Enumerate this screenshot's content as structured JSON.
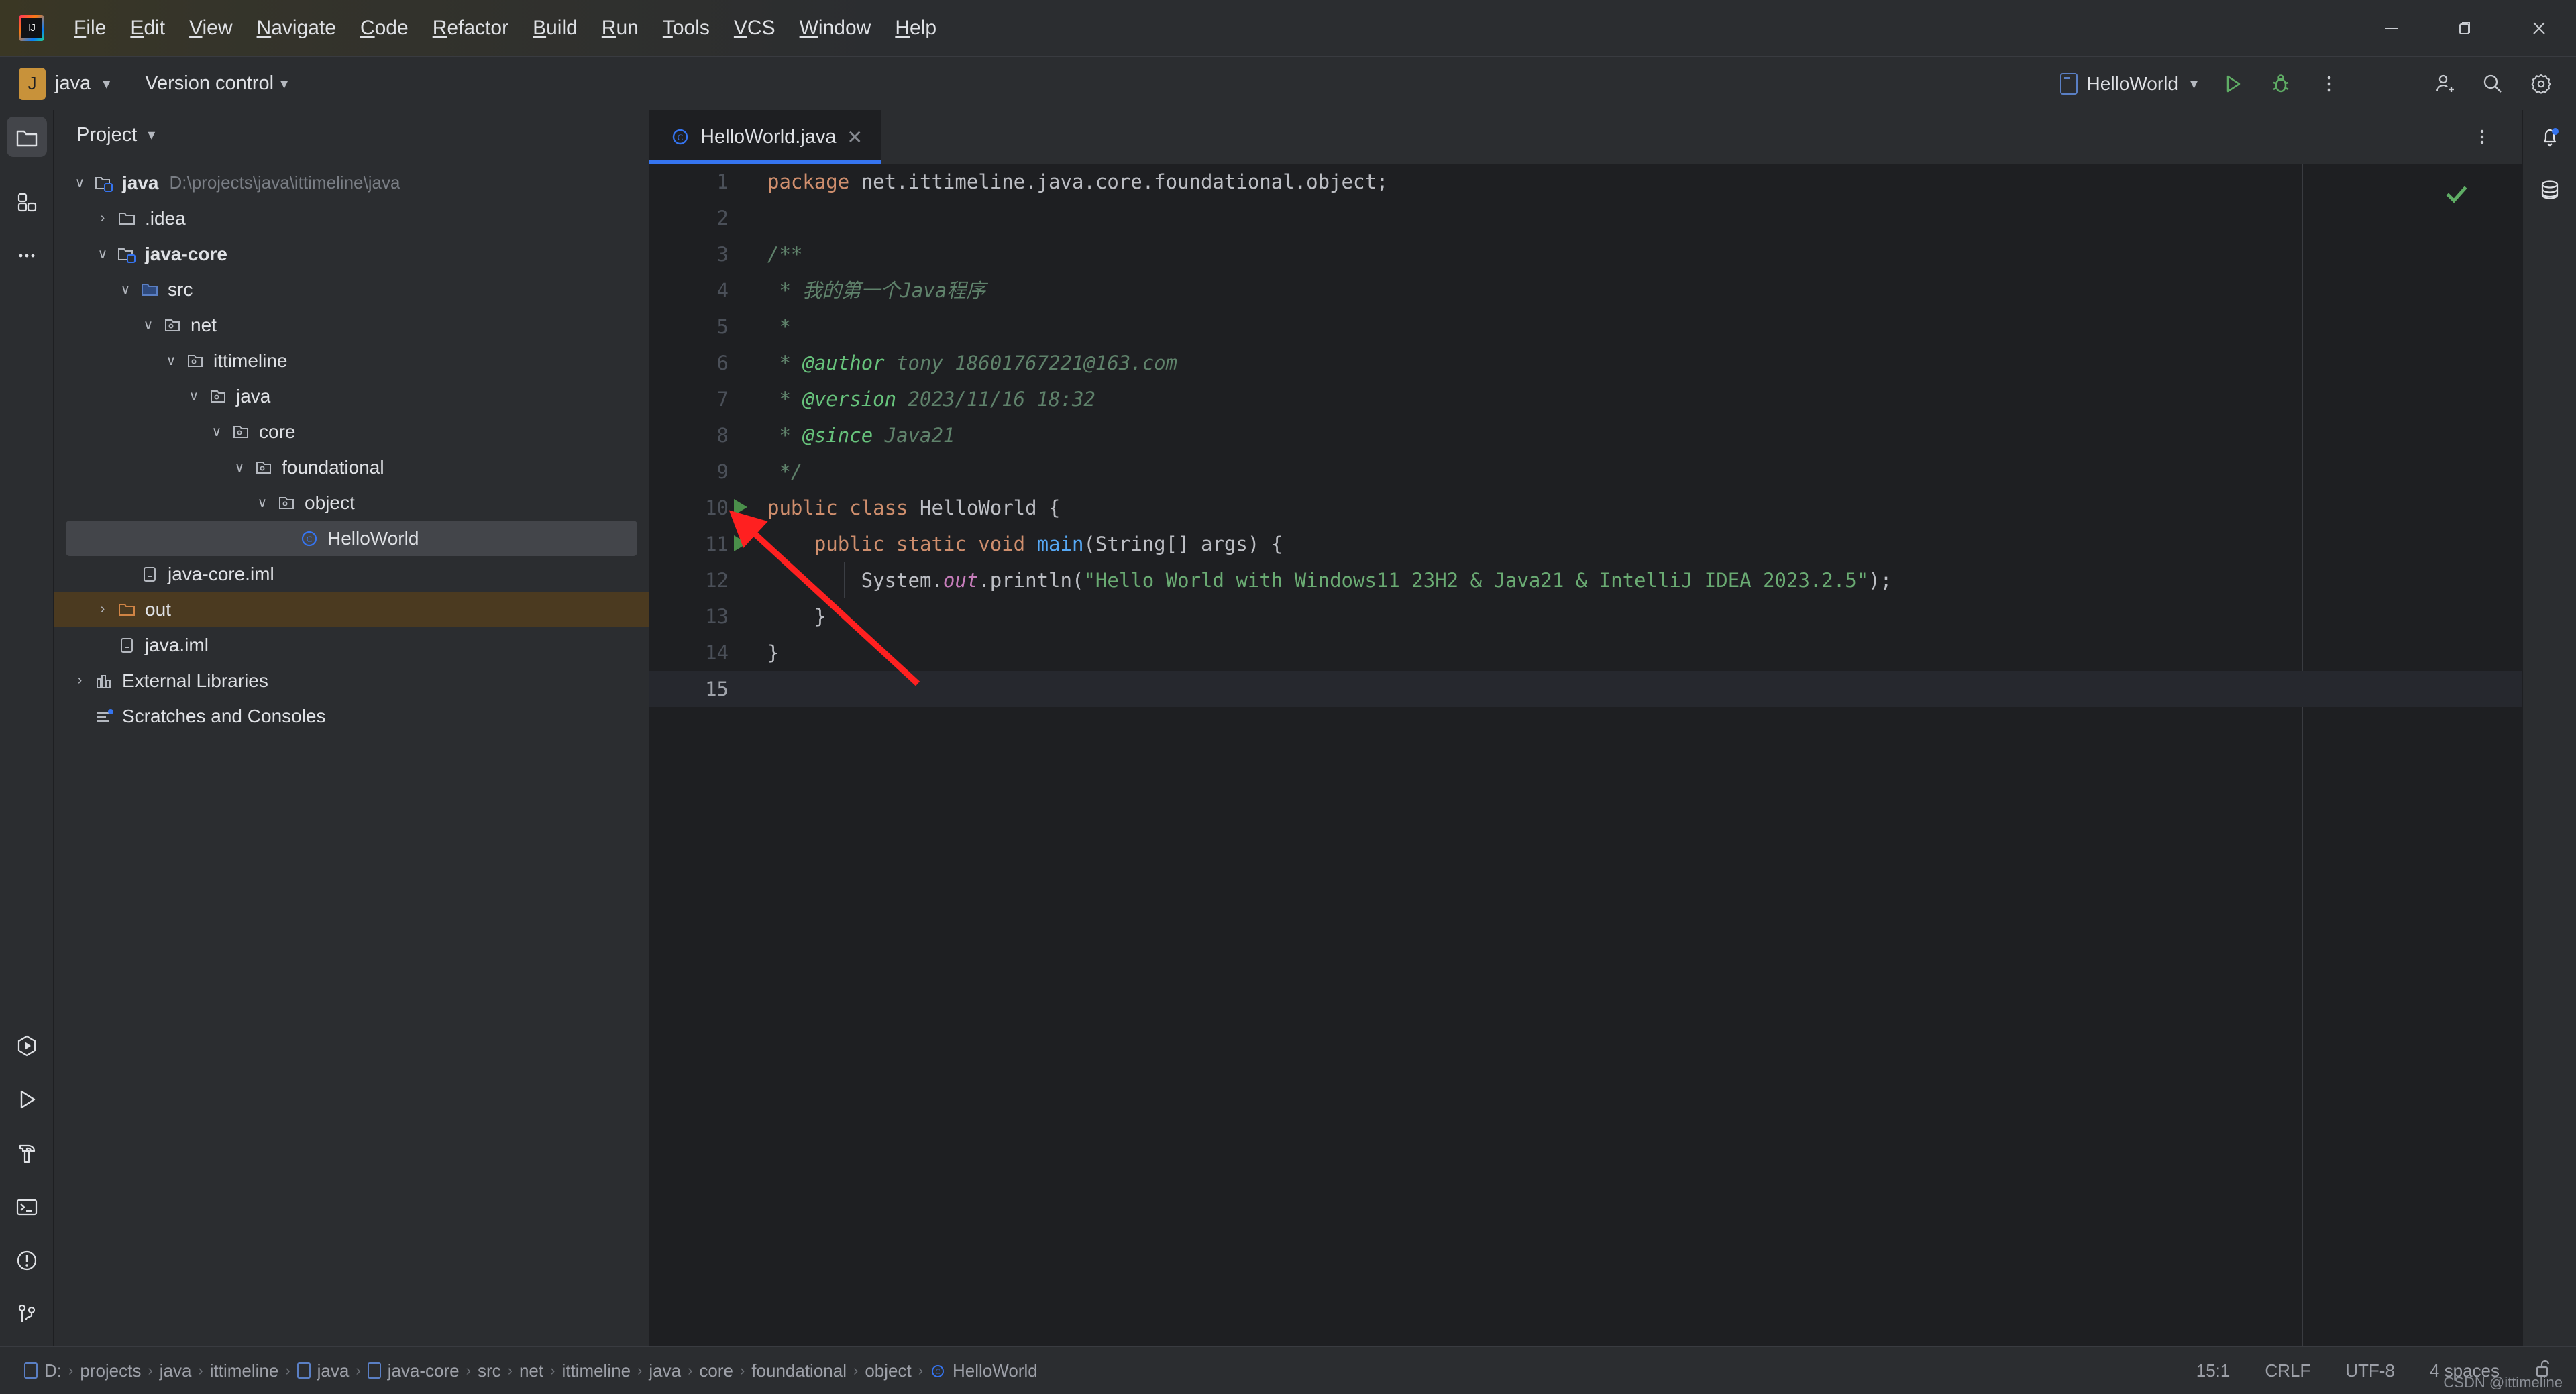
{
  "window": {
    "app_logo": "intellij-idea-logo",
    "controls": {
      "minimize": "–",
      "maximize": "❐",
      "close": "✕"
    }
  },
  "menubar": {
    "items": [
      {
        "label": "File"
      },
      {
        "label": "Edit"
      },
      {
        "label": "View"
      },
      {
        "label": "Navigate"
      },
      {
        "label": "Code"
      },
      {
        "label": "Refactor"
      },
      {
        "label": "Build"
      },
      {
        "label": "Run"
      },
      {
        "label": "Tools"
      },
      {
        "label": "VCS"
      },
      {
        "label": "Window"
      },
      {
        "label": "Help"
      }
    ]
  },
  "toolbar": {
    "project_badge": "J",
    "project_name": "java",
    "vcs_label": "Version control",
    "run_config_name": "HelloWorld",
    "run_icon": "run-icon",
    "debug_icon": "debug-icon",
    "more_icon": "more-vertical-icon",
    "account_icon": "account-add-icon",
    "search_icon": "search-icon",
    "settings_icon": "gear-icon"
  },
  "left_rail": {
    "top": [
      {
        "name": "project-tool-window",
        "icon": "folder-icon",
        "active": true
      },
      {
        "name": "commit-tool-window",
        "icon": "squares-icon",
        "active": false
      },
      {
        "name": "more-tool-windows",
        "icon": "more-horizontal-icon",
        "active": false
      }
    ],
    "bottom": [
      {
        "name": "debug-tool-window",
        "icon": "debug-hexagon-icon"
      },
      {
        "name": "run-tool-window",
        "icon": "play-icon"
      },
      {
        "name": "build-tool-window",
        "icon": "hammer-icon"
      },
      {
        "name": "terminal-tool-window",
        "icon": "terminal-icon"
      },
      {
        "name": "problems-tool-window",
        "icon": "warning-circle-icon"
      },
      {
        "name": "version-control-tool-window",
        "icon": "git-branch-icon"
      }
    ]
  },
  "right_rail": {
    "items": [
      {
        "name": "notifications",
        "icon": "bell-icon",
        "badge": true
      },
      {
        "name": "database",
        "icon": "database-icon",
        "badge": false
      }
    ]
  },
  "project_panel": {
    "title": "Project",
    "tree": [
      {
        "indent": 0,
        "twisty": "∨",
        "icon": "module-folder-icon",
        "label": "java",
        "bold": true,
        "path": "D:\\projects\\java\\ittimeline\\java",
        "state": "normal"
      },
      {
        "indent": 1,
        "twisty": "›",
        "icon": "folder-icon",
        "label": ".idea",
        "path": "",
        "state": "normal"
      },
      {
        "indent": 1,
        "twisty": "∨",
        "icon": "module-folder-icon",
        "label": "java-core",
        "bold": true,
        "path": "",
        "state": "normal"
      },
      {
        "indent": 2,
        "twisty": "∨",
        "icon": "source-folder-icon",
        "label": "src",
        "path": "",
        "state": "normal"
      },
      {
        "indent": 3,
        "twisty": "∨",
        "icon": "package-icon",
        "label": "net",
        "path": "",
        "state": "normal"
      },
      {
        "indent": 4,
        "twisty": "∨",
        "icon": "package-icon",
        "label": "ittimeline",
        "path": "",
        "state": "normal"
      },
      {
        "indent": 5,
        "twisty": "∨",
        "icon": "package-icon",
        "label": "java",
        "path": "",
        "state": "normal"
      },
      {
        "indent": 6,
        "twisty": "∨",
        "icon": "package-icon",
        "label": "core",
        "path": "",
        "state": "normal"
      },
      {
        "indent": 7,
        "twisty": "∨",
        "icon": "package-icon",
        "label": "foundational",
        "path": "",
        "state": "normal"
      },
      {
        "indent": 8,
        "twisty": "∨",
        "icon": "package-icon",
        "label": "object",
        "path": "",
        "state": "normal"
      },
      {
        "indent": 9,
        "twisty": "",
        "icon": "java-class-icon",
        "label": "HelloWorld",
        "path": "",
        "state": "selected"
      },
      {
        "indent": 2,
        "twisty": "",
        "icon": "iml-file-icon",
        "label": "java-core.iml",
        "path": "",
        "state": "normal"
      },
      {
        "indent": 1,
        "twisty": "›",
        "icon": "excluded-folder-icon",
        "label": "out",
        "path": "",
        "state": "excluded"
      },
      {
        "indent": 1,
        "twisty": "",
        "icon": "iml-file-icon",
        "label": "java.iml",
        "path": "",
        "state": "normal"
      },
      {
        "indent": 0,
        "twisty": "›",
        "icon": "library-icon",
        "label": "External Libraries",
        "path": "",
        "state": "normal"
      },
      {
        "indent": 0,
        "twisty": "",
        "icon": "scratches-icon",
        "label": "Scratches and Consoles",
        "path": "",
        "state": "normal"
      }
    ]
  },
  "editor": {
    "tabs": [
      {
        "label": "HelloWorld.java",
        "icon": "java-class-icon",
        "active": true,
        "close_icon": "close-icon"
      }
    ],
    "options_icon": "more-vertical-icon",
    "inspection_status": "ok-checkmark",
    "caret_line": 15,
    "lines": [
      {
        "n": 1,
        "runnable": false,
        "indent_guide": false,
        "tokens": [
          {
            "t": "package ",
            "c": "kw"
          },
          {
            "t": "net.ittimeline.java.core.foundational.object;",
            "c": "id"
          }
        ]
      },
      {
        "n": 2,
        "runnable": false,
        "indent_guide": false,
        "tokens": []
      },
      {
        "n": 3,
        "runnable": false,
        "indent_guide": false,
        "tokens": [
          {
            "t": "/**",
            "c": "doc"
          }
        ]
      },
      {
        "n": 4,
        "runnable": false,
        "indent_guide": false,
        "tokens": [
          {
            "t": " * 我的第一个Java程序",
            "c": "doc"
          }
        ]
      },
      {
        "n": 5,
        "runnable": false,
        "indent_guide": false,
        "tokens": [
          {
            "t": " *",
            "c": "doc"
          }
        ]
      },
      {
        "n": 6,
        "runnable": false,
        "indent_guide": false,
        "tokens": [
          {
            "t": " * ",
            "c": "doc"
          },
          {
            "t": "@author",
            "c": "dtag"
          },
          {
            "t": " tony 18601767221@163.com",
            "c": "doc"
          }
        ]
      },
      {
        "n": 7,
        "runnable": false,
        "indent_guide": false,
        "tokens": [
          {
            "t": " * ",
            "c": "doc"
          },
          {
            "t": "@version",
            "c": "dtag"
          },
          {
            "t": " 2023/11/16 18:32",
            "c": "doc"
          }
        ]
      },
      {
        "n": 8,
        "runnable": false,
        "indent_guide": false,
        "tokens": [
          {
            "t": " * ",
            "c": "doc"
          },
          {
            "t": "@since",
            "c": "dtag"
          },
          {
            "t": " Java21",
            "c": "doc"
          }
        ]
      },
      {
        "n": 9,
        "runnable": false,
        "indent_guide": false,
        "tokens": [
          {
            "t": " */",
            "c": "doc"
          }
        ]
      },
      {
        "n": 10,
        "runnable": true,
        "indent_guide": false,
        "tokens": [
          {
            "t": "public class ",
            "c": "kw"
          },
          {
            "t": "HelloWorld",
            "c": "cls"
          },
          {
            "t": " {",
            "c": "id"
          }
        ]
      },
      {
        "n": 11,
        "runnable": true,
        "indent_guide": false,
        "tokens": [
          {
            "t": "    ",
            "c": "id"
          },
          {
            "t": "public static void ",
            "c": "kw"
          },
          {
            "t": "main",
            "c": "mth"
          },
          {
            "t": "(String[] args) {",
            "c": "id"
          }
        ]
      },
      {
        "n": 12,
        "runnable": false,
        "indent_guide": true,
        "tokens": [
          {
            "t": "        System.",
            "c": "id"
          },
          {
            "t": "out",
            "c": "fld"
          },
          {
            "t": ".println(",
            "c": "id"
          },
          {
            "t": "\"Hello World with Windows11 23H2 & Java21 & IntelliJ IDEA 2023.2.5\"",
            "c": "str"
          },
          {
            "t": ");",
            "c": "id"
          }
        ]
      },
      {
        "n": 13,
        "runnable": false,
        "indent_guide": false,
        "tokens": [
          {
            "t": "    }",
            "c": "id"
          }
        ]
      },
      {
        "n": 14,
        "runnable": false,
        "indent_guide": false,
        "tokens": [
          {
            "t": "}",
            "c": "id"
          }
        ]
      },
      {
        "n": 15,
        "runnable": false,
        "indent_guide": false,
        "tokens": []
      }
    ]
  },
  "statusbar": {
    "breadcrumbs": [
      {
        "label": "D:",
        "module": true
      },
      {
        "label": "projects",
        "module": false
      },
      {
        "label": "java",
        "module": false
      },
      {
        "label": "ittimeline",
        "module": false
      },
      {
        "label": "java",
        "module": true
      },
      {
        "label": "java-core",
        "module": true
      },
      {
        "label": "src",
        "module": false
      },
      {
        "label": "net",
        "module": false
      },
      {
        "label": "ittimeline",
        "module": false
      },
      {
        "label": "java",
        "module": false
      },
      {
        "label": "core",
        "module": false
      },
      {
        "label": "foundational",
        "module": false
      },
      {
        "label": "object",
        "module": false
      },
      {
        "label": "HelloWorld",
        "module": false,
        "class_icon": true
      }
    ],
    "separator": "›",
    "caret_position": "15:1",
    "line_separator": "CRLF",
    "encoding": "UTF-8",
    "indent": "4 spaces",
    "lock_icon": "unlocked-icon",
    "watermark": "CSDN @ittimeline"
  },
  "annotation": {
    "arrow_color": "#ff2020",
    "points_to": "run-gutter-icon-line-11"
  },
  "colors": {
    "accent_blue": "#3574f0",
    "background": "#1e1f22",
    "panel": "#2b2d30",
    "keyword_orange": "#cf8e6d",
    "string_green": "#6aab73",
    "doc_green": "#5f826b",
    "method_blue": "#56a8f5",
    "field_purple": "#c77dbb",
    "excluded_orange": "#4b3a20"
  }
}
